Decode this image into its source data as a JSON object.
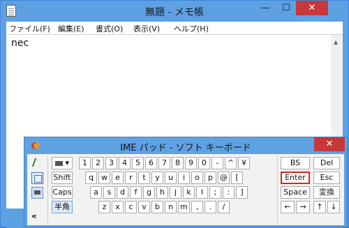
{
  "notepad": {
    "title": "無題 - メモ帳",
    "window_controls": {
      "minimize": "—",
      "maximize": "☐",
      "close": "✕"
    },
    "menu": [
      "ファイル(F)",
      "編集(E)",
      "書式(O)",
      "表示(V)",
      "ヘルプ(H)"
    ],
    "content": "nec"
  },
  "ime": {
    "title": "IME パッド - ソフト キーボード",
    "close": "✕",
    "side_chevron": "«",
    "left_keys": {
      "mode": "▾",
      "shift": "Shift",
      "caps": "Caps",
      "hankaku": "半角"
    },
    "rows": [
      [
        "1",
        "2",
        "3",
        "4",
        "5",
        "6",
        "7",
        "8",
        "9",
        "0",
        "-",
        "^",
        "¥"
      ],
      [
        "q",
        "w",
        "e",
        "r",
        "t",
        "y",
        "u",
        "i",
        "o",
        "p",
        "@",
        "["
      ],
      [
        "a",
        "s",
        "d",
        "f",
        "g",
        "h",
        "j",
        "k",
        "l",
        ";",
        ":",
        "]"
      ],
      [
        "z",
        "x",
        "c",
        "v",
        "b",
        "n",
        "m",
        ",",
        ".",
        "/"
      ]
    ],
    "right_keys": {
      "bs": "BS",
      "del": "Del",
      "enter": "Enter",
      "esc": "Esc",
      "space": "Space",
      "henkan": "変換",
      "left": "←",
      "right": "→",
      "up": "↑",
      "down": "↓"
    }
  }
}
